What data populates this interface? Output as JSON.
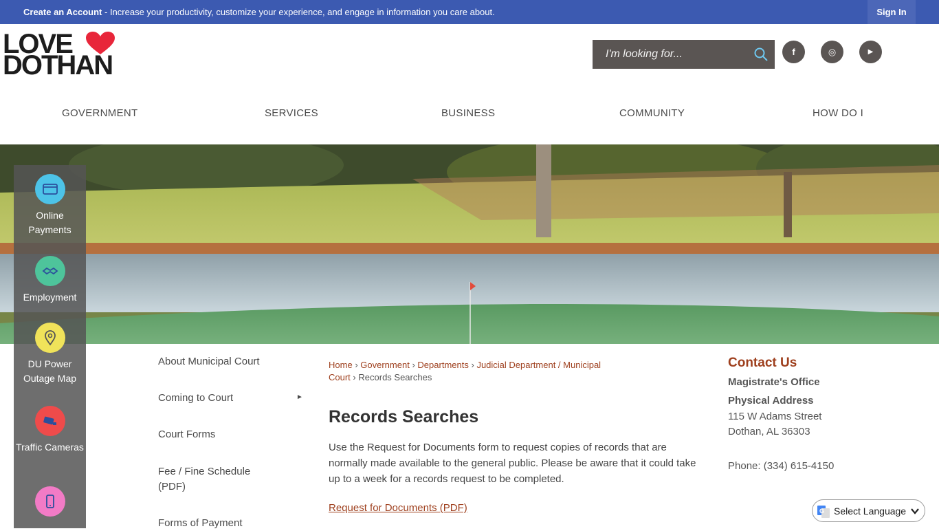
{
  "topbar": {
    "create_account": "Create an Account",
    "message": " - Increase your productivity, customize your experience, and engage in information you care about.",
    "sign_in": "Sign In"
  },
  "logo": {
    "line1": "LOVE",
    "line2": "DOTHAN"
  },
  "search": {
    "placeholder": "I'm looking for..."
  },
  "social": {
    "facebook": "f",
    "instagram": "◎",
    "youtube": "▶"
  },
  "nav": {
    "items": [
      "GOVERNMENT",
      "SERVICES",
      "BUSINESS",
      "COMMUNITY",
      "HOW DO I"
    ]
  },
  "quick_links": [
    {
      "label": "Online Payments",
      "color": "#4dc3e8",
      "icon": "credit-card-icon"
    },
    {
      "label": "Employment",
      "color": "#4ec49b",
      "icon": "handshake-icon"
    },
    {
      "label": "DU Power Outage Map",
      "color": "#f0e35a",
      "icon": "map-pin-icon"
    },
    {
      "label": "Traffic Cameras",
      "color": "#ef4b4b",
      "icon": "camera-icon"
    },
    {
      "label": "",
      "color": "#f27bc6",
      "icon": "phone-icon"
    }
  ],
  "subnav": {
    "items": [
      "About Municipal Court",
      "Coming to Court",
      "Court Forms",
      "Fee / Fine Schedule (PDF)",
      "Forms of Payment"
    ]
  },
  "breadcrumb": {
    "home": "Home",
    "government": "Government",
    "departments": "Departments",
    "judicial": "Judicial Department / Municipal Court",
    "current": "Records Searches",
    "sep": "›"
  },
  "page": {
    "title": "Records Searches",
    "body": "Use the Request for Documents form to request copies of records that are normally made available to the general public. Please be aware that it could take up to a week for a records request to be completed.",
    "link": "Request for Documents (PDF)"
  },
  "contact": {
    "heading": "Contact Us",
    "office": "Magistrate's Office",
    "address_label": "Physical Address",
    "street": "115 W Adams Street",
    "city": "Dothan, AL 36303",
    "phone": "Phone: (334) 615-4150"
  },
  "translate": {
    "label": "Select Language"
  },
  "colors": {
    "topbar": "#3c5ab1",
    "accent": "#9e3f1d",
    "heart": "#e8263a",
    "search_bg": "#5a5553"
  }
}
